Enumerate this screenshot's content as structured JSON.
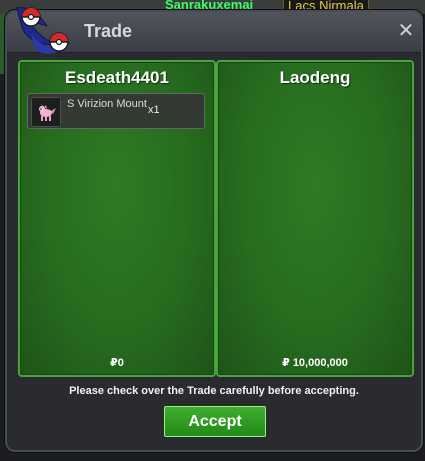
{
  "background": {
    "player_name": "Sanrakuxemai",
    "tag": "Lacs Nirmala"
  },
  "window": {
    "title": "Trade",
    "close_glyph": "✕"
  },
  "left_panel": {
    "player": "Esdeath4401",
    "items": [
      {
        "name": "S Virizion Mount",
        "quantity": "x1",
        "icon": "pink-pokemon-mount-icon"
      }
    ],
    "money": "₽0"
  },
  "right_panel": {
    "player": "Laodeng",
    "items": [],
    "money": "₽ 10,000,000"
  },
  "notice": "Please check over the Trade carefully before accepting.",
  "accept_label": "Accept",
  "colors": {
    "panel_green": "#2a7322",
    "panel_border": "#46a63a",
    "window_bg": "#2a2b31",
    "title_text": "#d7d8dc",
    "accept_green": "#2f9c22"
  }
}
